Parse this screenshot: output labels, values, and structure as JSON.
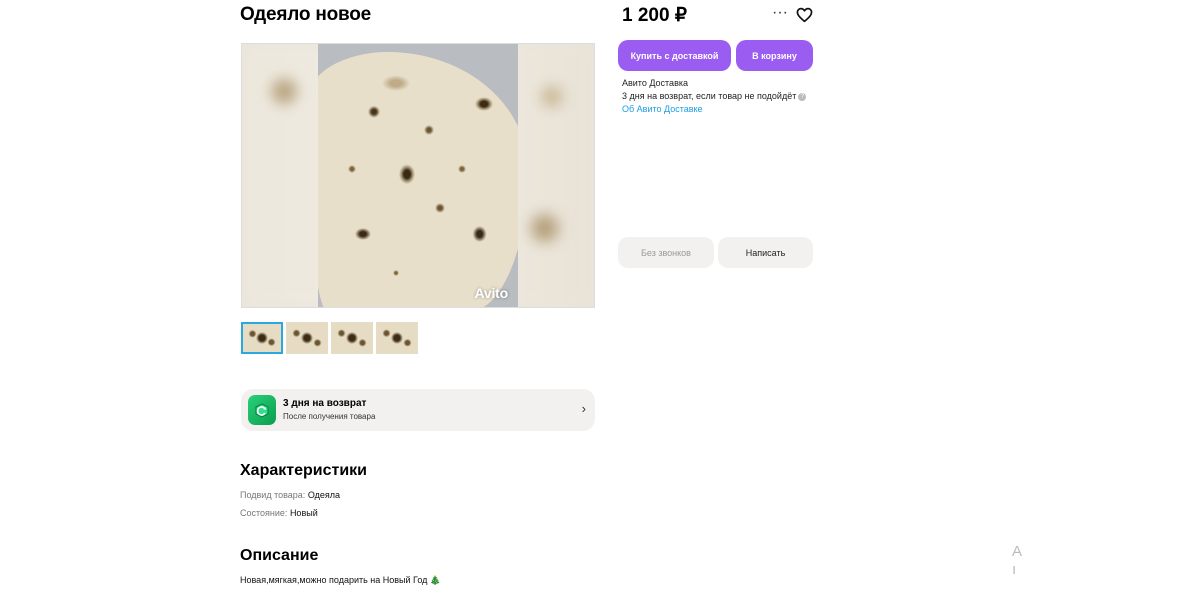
{
  "listing": {
    "title": "Одеяло новое",
    "price": "1 200 ₽",
    "watermark": "Avito"
  },
  "actions": {
    "more_icon": "more-dots-icon",
    "favorite_icon": "heart-icon",
    "buy_with_delivery": "Купить с доставкой",
    "add_to_cart": "В корзину",
    "no_calls": "Без звонков",
    "write": "Написать"
  },
  "delivery": {
    "line1": "Авито Доставка",
    "line2": "3 дня на возврат, если товар не подойдёт",
    "info_icon": "info-icon",
    "link": "Об Авито Доставке"
  },
  "gallery": {
    "thumbnail_count": 4,
    "active_index": 0
  },
  "return_banner": {
    "title": "3 дня на возврат",
    "subtitle": "После получения товара",
    "icon": "return-box-icon"
  },
  "characteristics": {
    "heading": "Характеристики",
    "rows": [
      {
        "label": "Подвид товара:",
        "value": "Одеяла"
      },
      {
        "label": "Состояние:",
        "value": "Новый"
      }
    ]
  },
  "description": {
    "heading": "Описание",
    "text": "Новая,мягкая,можно подарить на Новый Год 🎄"
  },
  "colors": {
    "accent_purple": "#9b5cf2",
    "link_blue": "#1a9ee6",
    "return_green": "#16b35f",
    "thumb_active_border": "#2aa9e0"
  }
}
